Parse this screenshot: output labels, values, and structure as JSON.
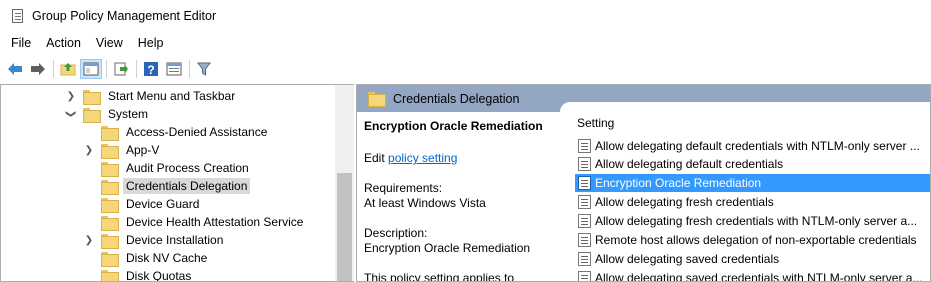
{
  "window": {
    "title": "Group Policy Management Editor"
  },
  "menu": [
    "File",
    "Action",
    "View",
    "Help"
  ],
  "toolbar": [
    "back-arrow-icon",
    "forward-arrow-icon",
    "up-folder-icon",
    "show-hide-tree-icon",
    "export-list-icon",
    "help-icon",
    "properties-icon",
    "filter-icon"
  ],
  "tree": [
    {
      "label": "Start Menu and Taskbar",
      "depth": 0,
      "expander": "collapsed"
    },
    {
      "label": "System",
      "depth": 0,
      "expander": "expanded"
    },
    {
      "label": "Access-Denied Assistance",
      "depth": 1,
      "expander": "none"
    },
    {
      "label": "App-V",
      "depth": 1,
      "expander": "collapsed"
    },
    {
      "label": "Audit Process Creation",
      "depth": 1,
      "expander": "none"
    },
    {
      "label": "Credentials Delegation",
      "depth": 1,
      "expander": "none",
      "selected": true
    },
    {
      "label": "Device Guard",
      "depth": 1,
      "expander": "none"
    },
    {
      "label": "Device Health Attestation Service",
      "depth": 1,
      "expander": "none"
    },
    {
      "label": "Device Installation",
      "depth": 1,
      "expander": "collapsed"
    },
    {
      "label": "Disk NV Cache",
      "depth": 1,
      "expander": "none"
    },
    {
      "label": "Disk Quotas",
      "depth": 1,
      "expander": "none"
    }
  ],
  "right": {
    "header": "Credentials Delegation",
    "desc_title": "Encryption Oracle Remediation",
    "edit_prefix": "Edit ",
    "edit_link": "policy setting",
    "requirements_label": "Requirements:",
    "requirements_value": "At least Windows Vista",
    "description_label": "Description:",
    "description_value": "Encryption Oracle Remediation",
    "description_more": "This policy setting applies to",
    "column_header": "Setting",
    "settings": [
      {
        "label": "Allow delegating default credentials with NTLM-only server ..."
      },
      {
        "label": "Allow delegating default credentials"
      },
      {
        "label": "Encryption Oracle Remediation",
        "selected": true
      },
      {
        "label": "Allow delegating fresh credentials"
      },
      {
        "label": "Allow delegating fresh credentials with NTLM-only server a..."
      },
      {
        "label": "Remote host allows delegation of non-exportable credentials"
      },
      {
        "label": "Allow delegating saved credentials"
      },
      {
        "label": "Allow delegating saved credentials with NTLM-only server a..."
      }
    ]
  }
}
